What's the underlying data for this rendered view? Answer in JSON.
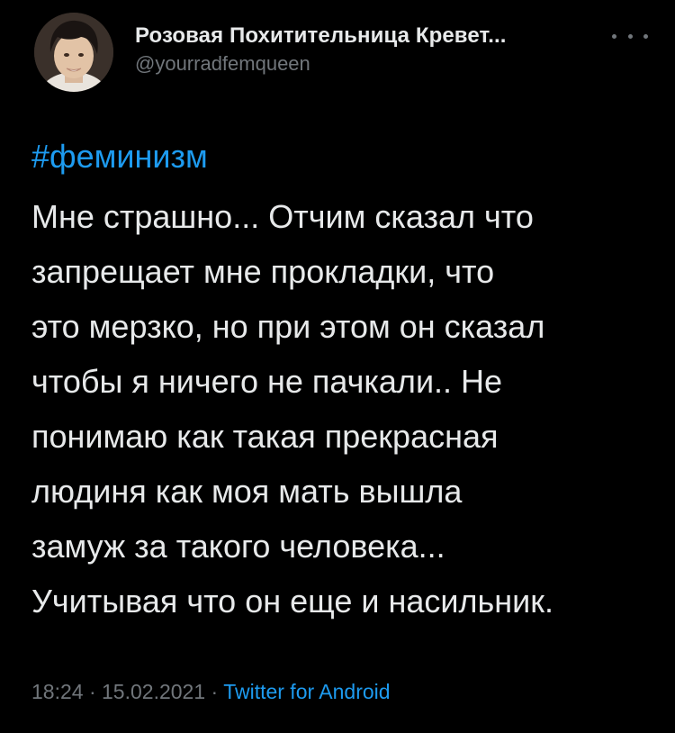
{
  "author": {
    "display_name": "Розовая Похитительница Кревет...",
    "handle": "@yourradfemqueen",
    "avatar_icon": "profile-photo"
  },
  "tweet": {
    "hashtag": "#феминизм",
    "lines": [
      "Мне страшно... Отчим сказал что",
      "запрещает мне прокладки, что",
      "это мерзко, но при этом он сказал",
      "чтобы я ничего не пачкали.. Не",
      "понимаю как такая прекрасная",
      "людиня как моя мать вышла",
      "замуж за такого человека...",
      "Учитывая что он еще и насильник."
    ]
  },
  "meta": {
    "time": "18:24",
    "separator": "·",
    "date": "15.02.2021",
    "source": "Twitter for Android"
  },
  "colors": {
    "background": "#000000",
    "text": "#e7e9ea",
    "secondary": "#71767b",
    "accent": "#1d9bf0"
  }
}
